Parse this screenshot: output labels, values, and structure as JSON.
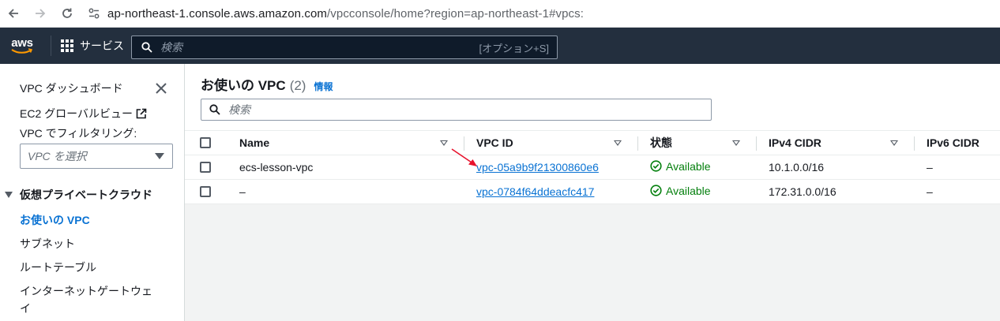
{
  "browser": {
    "url_host": "ap-northeast-1.console.aws.amazon.com",
    "url_path": "/vpcconsole/home?region=ap-northeast-1#vpcs:"
  },
  "topnav": {
    "logo": "aws",
    "services_label": "サービス",
    "search_placeholder": "検索",
    "search_shortcut": "[オプション+S]"
  },
  "sidebar": {
    "dashboard": "VPC ダッシュボード",
    "ec2_global_view": "EC2 グローバルビュー",
    "filter_label": "VPC でフィルタリング:",
    "select_placeholder": "VPC を選択",
    "section_title": "仮想プライベートクラウド",
    "items": [
      "お使いの VPC",
      "サブネット",
      "ルートテーブル",
      "インターネットゲートウェ",
      "イ"
    ]
  },
  "main": {
    "title": "お使いの VPC",
    "count": "(2)",
    "info": "情報",
    "filter_placeholder": "検索",
    "columns": [
      "Name",
      "VPC ID",
      "状態",
      "IPv4 CIDR",
      "IPv6 CIDR"
    ],
    "rows": [
      {
        "name": "ecs-lesson-vpc",
        "vpc_id": "vpc-05a9b9f21300860e6",
        "state": "Available",
        "ipv4": "10.1.0.0/16",
        "ipv6": "–"
      },
      {
        "name": "–",
        "vpc_id": "vpc-0784f64ddeacfc417",
        "state": "Available",
        "ipv4": "172.31.0.0/16",
        "ipv6": "–"
      }
    ]
  },
  "colors": {
    "nav_bg": "#232f3e",
    "link": "#0972d3",
    "success": "#037f0c",
    "annotation_arrow": "#e8132d"
  }
}
